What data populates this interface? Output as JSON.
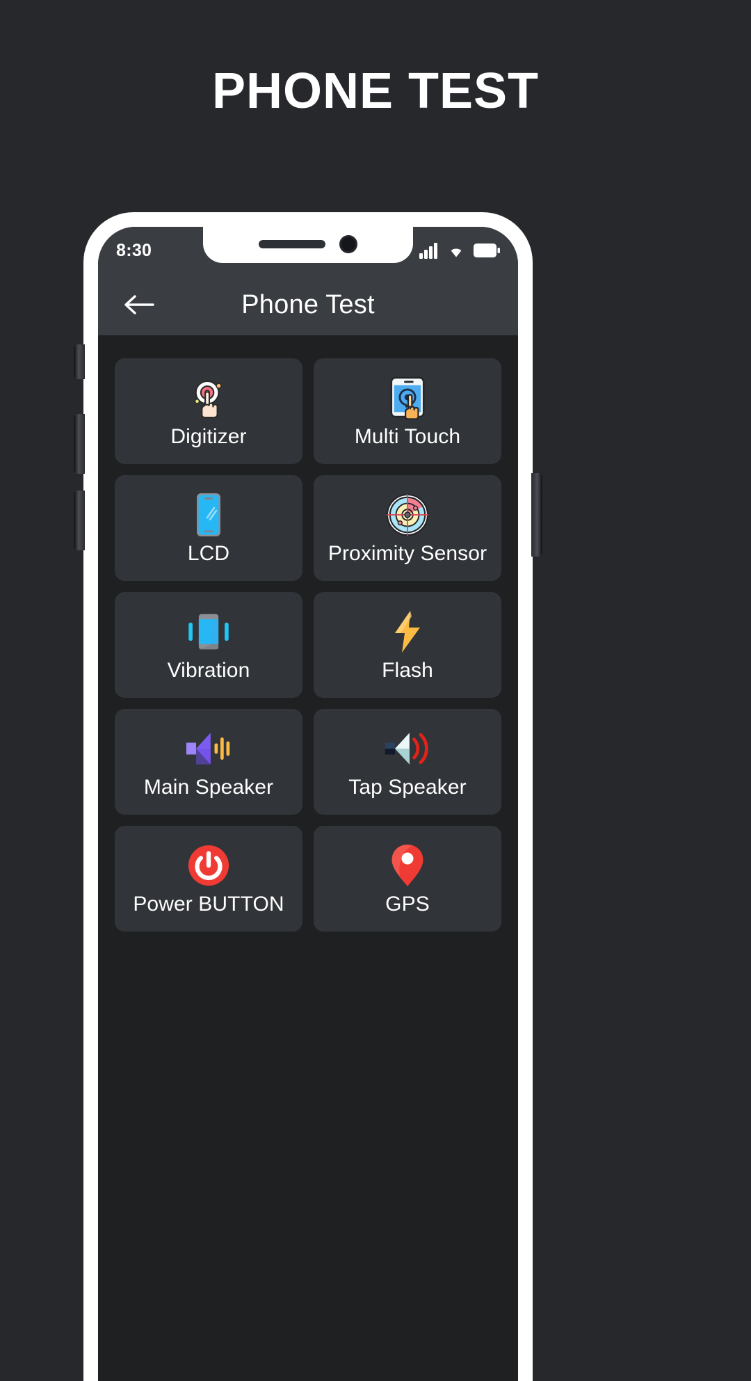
{
  "page": {
    "title": "PHONE TEST",
    "background_color": "#26282b"
  },
  "device": {
    "frame_color": "#ffffff",
    "screen_background": "#1e2022"
  },
  "status_bar": {
    "time": "8:30",
    "icons": [
      "signal-icon",
      "wifi-icon",
      "battery-icon"
    ],
    "background_color": "#3a3d42"
  },
  "app_bar": {
    "back_icon": "arrow-left-icon",
    "title": "Phone Test",
    "background_color": "#3a3d42"
  },
  "grid": {
    "tile_color": "#313438",
    "items": [
      {
        "label": "Digitizer",
        "icon": "digitizer-touch-icon"
      },
      {
        "label": "Multi Touch",
        "icon": "multi-touch-icon"
      },
      {
        "label": "LCD",
        "icon": "lcd-screen-icon"
      },
      {
        "label": "Proximity Sensor",
        "icon": "proximity-radar-icon"
      },
      {
        "label": "Vibration",
        "icon": "vibration-icon"
      },
      {
        "label": "Flash",
        "icon": "flash-bolt-icon"
      },
      {
        "label": "Main Speaker",
        "icon": "main-speaker-icon"
      },
      {
        "label": "Tap Speaker",
        "icon": "tap-speaker-icon"
      },
      {
        "label": "Power BUTTON",
        "icon": "power-button-icon"
      },
      {
        "label": "GPS",
        "icon": "gps-pin-icon"
      }
    ]
  },
  "colors": {
    "accent_red": "#ef3b34",
    "accent_blue": "#34a8f0",
    "accent_yellow": "#fcbb42",
    "accent_purple": "#7c5cf0",
    "accent_cyan": "#1ec8f5"
  }
}
